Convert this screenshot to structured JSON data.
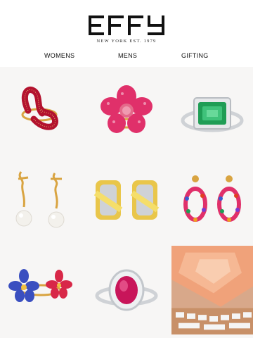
{
  "brand": {
    "logo_text": "EFFY",
    "tagline": "NEW YORK EST. 1979"
  },
  "nav": {
    "items": [
      {
        "label": "WOMENS"
      },
      {
        "label": "MENS"
      },
      {
        "label": "GIFTING"
      }
    ]
  },
  "products": [
    {
      "name": "ruby-wrap-ring-image"
    },
    {
      "name": "pink-sapphire-flower-ring-image"
    },
    {
      "name": "emerald-diamond-ring-image"
    },
    {
      "name": "pearl-bow-earrings-image"
    },
    {
      "name": "yellow-diamond-hoop-earrings-image"
    },
    {
      "name": "multi-sapphire-drop-earrings-image"
    },
    {
      "name": "flower-bypass-ring-image"
    },
    {
      "name": "ruby-halo-ring-image"
    },
    {
      "name": "morganite-closeup-image"
    }
  ],
  "colors": {
    "ruby": "#b3122e",
    "pink": "#e0306a",
    "emerald": "#1f9d55",
    "gold": "#d9a441",
    "silver": "#cfd2d6",
    "morganite": "#f0a27a"
  }
}
